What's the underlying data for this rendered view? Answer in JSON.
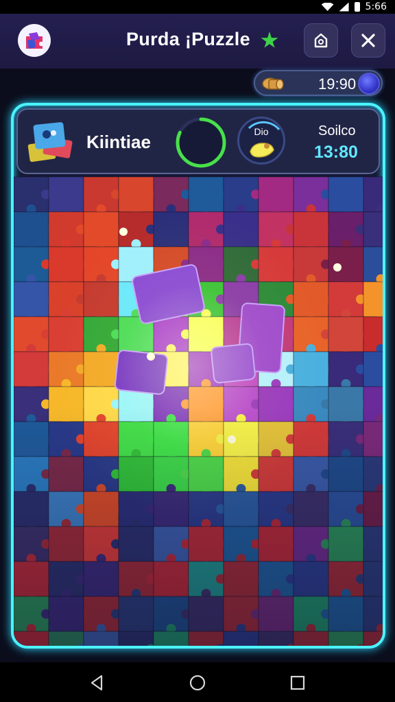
{
  "status_bar": {
    "time": "5:66"
  },
  "header": {
    "title": "Purda ¡Puzzle"
  },
  "coins": {
    "value": "19:90"
  },
  "info_panel": {
    "level_label": "Kiintiae",
    "hint_label": "Dio",
    "score_label": "Soilco",
    "score_value": "13:80",
    "progress": 0.82
  },
  "puzzle": {
    "cols": 11,
    "rows": 15,
    "tiles": [
      [
        "#2a2f6e",
        "#3b3a8c",
        "#c9392f",
        "#d8462e",
        "#7a2a5c",
        "#1f5a9a",
        "#2a3d8a",
        "#a32a82",
        "#7a2f9a",
        "#2a4da0",
        "#3a2a7a"
      ],
      [
        "#1e4f8f",
        "#d13b2e",
        "#e24a2a",
        "#b62b2b",
        "#2b2f7a",
        "#b02a6e",
        "#3a2f8a",
        "#c23262",
        "#c9343a",
        "#6a1f6a",
        "#3a2f7a"
      ],
      [
        "#1c5b96",
        "#d93a2c",
        "#e4462a",
        "#9ff0ff",
        "#d44a2a",
        "#8a2a8a",
        "#2f6a3a",
        "#d63a3a",
        "#c8393a",
        "#7a1f4a",
        "#2a4e9a"
      ],
      [
        "#3555a8",
        "#d9412b",
        "#c53a30",
        "#6ae8ff",
        "#7bd83a",
        "#3ac23a",
        "#8a3aaa",
        "#2c8a3a",
        "#e25a2a",
        "#d33a3a",
        "#f4932a"
      ],
      [
        "#e24a2e",
        "#d93f33",
        "#33a83a",
        "#4adc5a",
        "#a93ad0",
        "#f8ff5a",
        "#b83a9a",
        "#c23a7a",
        "#e8632a",
        "#d2453a",
        "#c82c2c"
      ],
      [
        "#d33a3a",
        "#ea7a2a",
        "#f4a92a",
        "#58ea5a",
        "#fff36a",
        "#a13ac8",
        "#c24ac8",
        "#b7f0ff",
        "#4ab0e0",
        "#3a2a7a",
        "#2a4da0"
      ],
      [
        "#3a2f7a",
        "#f6b82a",
        "#ffd84a",
        "#9cf5ff",
        "#7a2fc0",
        "#ff9a3a",
        "#b84ad0",
        "#9a3ac0",
        "#3a8ac0",
        "#3a78a8",
        "#6a2a9a"
      ],
      [
        "#1f5a9a",
        "#2a3a8a",
        "#e4442e",
        "#3ee04a",
        "#3ae34a",
        "#ffd23a",
        "#f7f24a",
        "#e4c23a",
        "#d23a3a",
        "#3a2f7a",
        "#7a2a7a"
      ],
      [
        "#2a7ac0",
        "#7a2a4a",
        "#2a3a8a",
        "#2fc03a",
        "#38d84a",
        "#4ad84a",
        "#f4e23a",
        "#d03a3a",
        "#3a5aa8",
        "#1f4a8a",
        "#2a3a7a"
      ],
      [
        "#2a2f6e",
        "#3b7ac0",
        "#d44a2a",
        "#2a2f7a",
        "#3a2a7a",
        "#2a3a8a",
        "#2a5aa0",
        "#2a3a8a",
        "#3a2f6a",
        "#2a4e9a",
        "#6a1f4a"
      ],
      [
        "#3a2f6a",
        "#9a2a3a",
        "#d23a3a",
        "#2a2f6e",
        "#3a5aa8",
        "#b02a3a",
        "#1f5a9a",
        "#b0283a",
        "#6a2a8a",
        "#2a8a5a",
        "#2a3a7a"
      ],
      [
        "#b02a3a",
        "#2a2f6e",
        "#3a2a7a",
        "#9a2a3a",
        "#b0283a",
        "#1f8a8a",
        "#9a2a3a",
        "#1f5a9a",
        "#2a3a8a",
        "#9a2a3a",
        "#2a3a7a"
      ],
      [
        "#2a8a5a",
        "#3a2a7a",
        "#9a2a3a",
        "#2a3a7a",
        "#1f4a8a",
        "#3a2f6a",
        "#9a2a3a",
        "#6a2a7a",
        "#1f8a6a",
        "#1f5a9a",
        "#2a3a7a"
      ],
      [
        "#b0283a",
        "#2a7a5a",
        "#3a5aa8",
        "#2a2f6e",
        "#1f8a6a",
        "#9a2a3a",
        "#2a3a8a",
        "#3a2f6a",
        "#9a2a3a",
        "#2a8a5a",
        "#9a2a3a"
      ],
      [
        "#2a3a7a",
        "#1f5a9a",
        "#7a2a7a",
        "#2a8a5a",
        "#2a3a8a",
        "#9a2a3a",
        "#3a2f6a",
        "#1f8a8a",
        "#2a3a7a",
        "#9a2a3a",
        "#2a3a7a"
      ]
    ],
    "loose_pieces": [
      {
        "color": "#8a4ad8"
      },
      {
        "color": "#a04ad0"
      },
      {
        "color": "#7a3ac8"
      },
      {
        "color": "#9a50d8"
      }
    ]
  }
}
